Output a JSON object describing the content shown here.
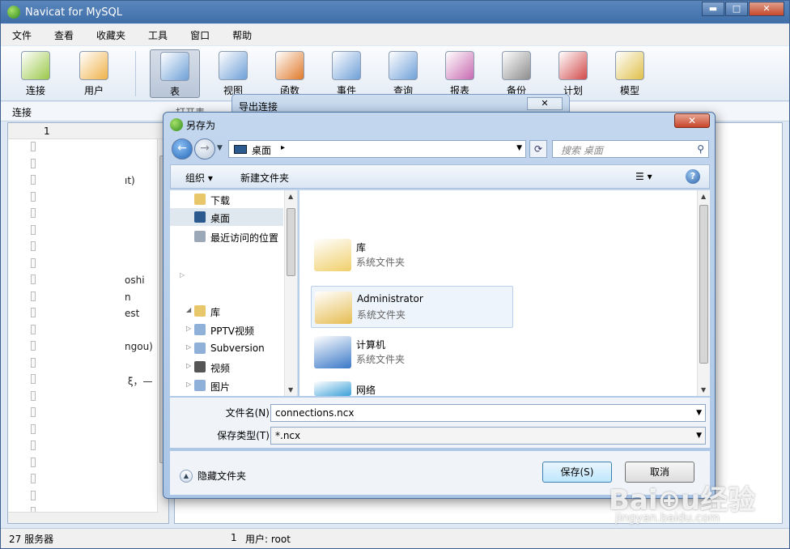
{
  "app": {
    "title": "Navicat for MySQL"
  },
  "window_buttons": {
    "minimize": "▬",
    "maximize": "□",
    "close": "✕"
  },
  "menu": [
    "文件",
    "查看",
    "收藏夹",
    "工具",
    "窗口",
    "帮助"
  ],
  "toolbar": [
    {
      "label": "连接",
      "icon": "connection-icon",
      "color": "#9bc84a"
    },
    {
      "label": "用户",
      "icon": "user-icon",
      "color": "#f0b24a"
    },
    {
      "label": "表",
      "icon": "table-icon",
      "color": "#6fa0d8",
      "active": true
    },
    {
      "label": "视图",
      "icon": "view-icon",
      "color": "#6fa0d8"
    },
    {
      "label": "函数",
      "icon": "function-icon",
      "color": "#e07a2a"
    },
    {
      "label": "事件",
      "icon": "event-icon",
      "color": "#6fa0d8"
    },
    {
      "label": "查询",
      "icon": "query-icon",
      "color": "#6fa0d8"
    },
    {
      "label": "报表",
      "icon": "report-icon",
      "color": "#c86ab0"
    },
    {
      "label": "备份",
      "icon": "backup-icon",
      "color": "#8c8c8c"
    },
    {
      "label": "计划",
      "icon": "schedule-icon",
      "color": "#d24a4a"
    },
    {
      "label": "模型",
      "icon": "model-icon",
      "color": "#e0c04a"
    }
  ],
  "subbar": {
    "connections_label": "连接",
    "open_table": "打开表"
  },
  "leftpane": {
    "header_num": "1",
    "rows": [
      "",
      "",
      "ıt)",
      "",
      "",
      "",
      "",
      "",
      "oshi",
      "n",
      "est",
      "",
      "ngou)",
      "",
      " ξ，—",
      "",
      "",
      "",
      "",
      "",
      "",
      "",
      ""
    ]
  },
  "status": {
    "servers": "27 服务器",
    "count": "1",
    "user": "用户: root"
  },
  "export_dialog": {
    "title": "导出连接",
    "close": "✕"
  },
  "save_dialog": {
    "title": "另存为",
    "close": "✕",
    "path": {
      "location": "桌面",
      "arrow": "▸"
    },
    "search_placeholder": "搜索 桌面",
    "organize": "组织 ▾",
    "new_folder": "新建文件夹",
    "view_toggle": "☰ ▾",
    "help": "?",
    "nav_items": [
      {
        "label": "下载",
        "icon": "download-folder-icon",
        "color": "#e8c66a"
      },
      {
        "label": "桌面",
        "icon": "desktop-icon",
        "color": "#2a5a8e",
        "selected": true
      },
      {
        "label": "最近访问的位置",
        "icon": "recent-places-icon",
        "color": "#9aa8b8"
      },
      {
        "label": "库",
        "icon": "library-icon",
        "color": "#e8c66a"
      },
      {
        "label": "PPTV视频",
        "icon": "pptv-library-icon",
        "color": "#8fb0d8"
      },
      {
        "label": "Subversion",
        "icon": "subversion-library-icon",
        "color": "#8fb0d8"
      },
      {
        "label": "视频",
        "icon": "video-library-icon",
        "color": "#555555"
      },
      {
        "label": "图片",
        "icon": "pictures-library-icon",
        "color": "#8fb0d8"
      }
    ],
    "files": [
      {
        "name": "库",
        "desc": "系统文件夹",
        "icon": "library-folder-icon",
        "color": "#f0cf6a"
      },
      {
        "name": "Administrator",
        "desc": "系统文件夹",
        "icon": "user-folder-icon",
        "color": "#e6bd52"
      },
      {
        "name": "计算机",
        "desc": "系统文件夹",
        "icon": "computer-icon",
        "color": "#3a78c8"
      },
      {
        "name": "网络",
        "desc": "",
        "icon": "network-icon",
        "color": "#3aa0d8"
      }
    ],
    "filename_label": "文件名(N):",
    "filename_value": "connections.ncx",
    "filetype_label": "保存类型(T):",
    "filetype_value": "*.ncx",
    "hide_folders": "隐藏文件夹",
    "save_button": "保存(S)",
    "cancel_button": "取消"
  },
  "watermark": {
    "brand": "Bai⊕u经验",
    "url": "jingyan.baidu.com"
  }
}
